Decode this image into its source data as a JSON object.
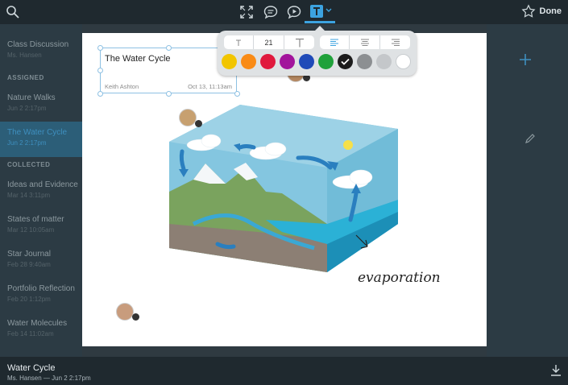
{
  "topbar": {
    "done_label": "Done"
  },
  "sidebar": {
    "items_top": [
      {
        "title": "Class Discussion",
        "sub": "Ms. Hansen"
      }
    ],
    "assigned_header": "ASSIGNED",
    "assigned": [
      {
        "title": "Nature Walks",
        "sub": "Jun 2 2:17pm"
      },
      {
        "title": "The Water Cycle",
        "sub": "Jun 2 2:17pm"
      }
    ],
    "collected_header": "COLLECTED",
    "collected": [
      {
        "title": "Ideas and Evidence",
        "sub": "Mar 14 3:11pm"
      },
      {
        "title": "States of matter",
        "sub": "Mar 12 10:05am"
      },
      {
        "title": "Star Journal",
        "sub": "Feb 28 9:40am"
      },
      {
        "title": "Portfolio Reflection",
        "sub": "Feb 20 1:12pm"
      },
      {
        "title": "Water Molecules",
        "sub": "Feb 14 11:02am"
      }
    ]
  },
  "textbox": {
    "title": "The Water Cycle",
    "author": "Keith Ashton",
    "date": "Oct 13, 11:13am"
  },
  "toolbar": {
    "font_size": "21",
    "colors": [
      "#f2c500",
      "#f98b16",
      "#e0193d",
      "#a2149c",
      "#1f4ab8",
      "#1fa13a",
      "#1c1c1c",
      "#8c8f92",
      "#c4c7ca",
      "#ffffff"
    ],
    "selected_color": "#1c1c1c"
  },
  "annotation": {
    "text": "evaporation"
  },
  "bottombar": {
    "title": "Water Cycle",
    "subtitle": "Ms. Hansen — Jun 2 2:17pm"
  }
}
